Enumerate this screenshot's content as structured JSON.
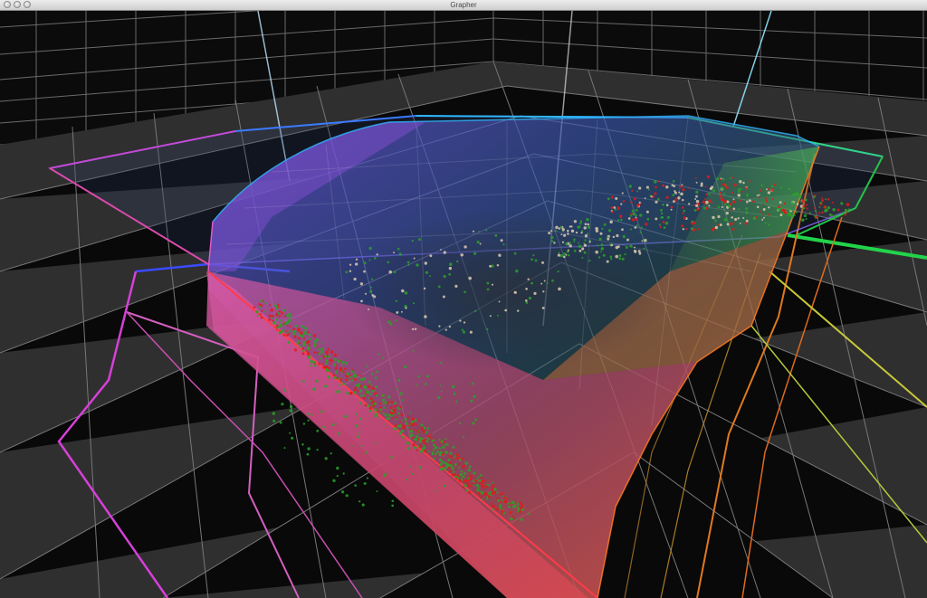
{
  "window": {
    "title": "Grapher",
    "controls": [
      "close",
      "minimize",
      "zoom"
    ]
  },
  "scene": {
    "description_kind": "3d-gamut-plot",
    "background_color": "#0b0b0b",
    "floor_color": "#2f2f2f",
    "grid_color": "#8a8a8a",
    "axis_color": "#bfe4ff",
    "gamut_colors": {
      "red": "#ff3b4a",
      "magenta": "#d640d8",
      "blue": "#2f5bff",
      "cyan": "#2fb7ff",
      "green": "#21c44a",
      "yellow": "#d8d43a",
      "orange": "#ff7a1f"
    },
    "point_colors": [
      "#e01a1a",
      "#2aa02a",
      "#d9c9b0"
    ]
  }
}
